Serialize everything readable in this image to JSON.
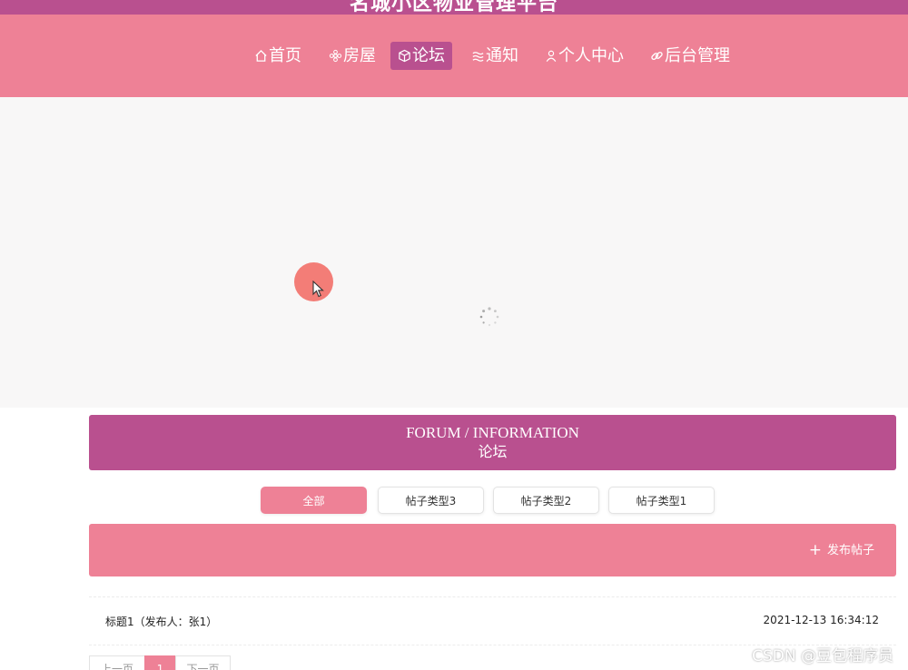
{
  "header": {
    "site_title": "名城小区物业管理平台",
    "nav": [
      {
        "label": "首页",
        "icon": "home-icon"
      },
      {
        "label": "房屋",
        "icon": "flower-icon"
      },
      {
        "label": "论坛",
        "icon": "cube-icon",
        "active": true
      },
      {
        "label": "通知",
        "icon": "wave-icon"
      },
      {
        "label": "个人中心",
        "icon": "user-icon"
      },
      {
        "label": "后台管理",
        "icon": "link-icon"
      }
    ]
  },
  "section": {
    "title_en": "FORUM / INFORMATION",
    "title_cn": "论坛"
  },
  "tabs": [
    {
      "label": "全部",
      "active": true
    },
    {
      "label": "帖子类型3"
    },
    {
      "label": "帖子类型2"
    },
    {
      "label": "帖子类型1"
    }
  ],
  "publish": {
    "label": "发布帖子",
    "icon": "plus-icon"
  },
  "posts": [
    {
      "title": "标题1（发布人：张1）",
      "time": "2021-12-13 16:34:12"
    }
  ],
  "pagination": {
    "prev": "上一页",
    "current": "1",
    "next": "下一页"
  },
  "watermark": "CSDN @豆包程序员",
  "colors": {
    "primary": "#b9508f",
    "accent": "#ee8196",
    "background": "#f8f7f7",
    "cursor": "#f2726b"
  }
}
